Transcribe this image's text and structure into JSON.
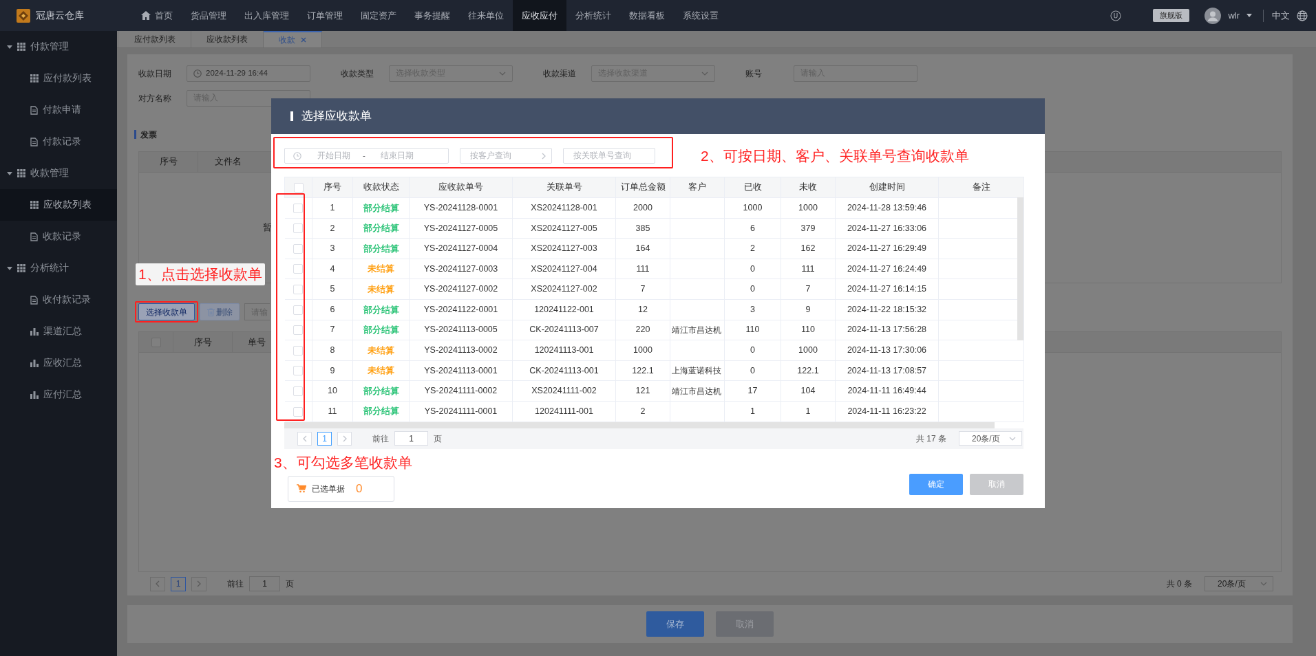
{
  "app": {
    "logo": "冠唐云仓库"
  },
  "top_nav": [
    {
      "label": "首页",
      "kind": "home",
      "selected": false
    },
    {
      "label": "货品管理",
      "kind": "link",
      "selected": false
    },
    {
      "label": "出入库管理",
      "kind": "link",
      "selected": false
    },
    {
      "label": "订单管理",
      "kind": "link",
      "selected": false
    },
    {
      "label": "固定资产",
      "kind": "link",
      "selected": false
    },
    {
      "label": "事务提醒",
      "kind": "link",
      "selected": false
    },
    {
      "label": "往来单位",
      "kind": "link",
      "selected": false
    },
    {
      "label": "应收应付",
      "kind": "link",
      "selected": true
    },
    {
      "label": "分析统计",
      "kind": "link",
      "selected": false
    },
    {
      "label": "数据看板",
      "kind": "link",
      "selected": false
    },
    {
      "label": "系统设置",
      "kind": "link",
      "selected": false
    }
  ],
  "header_right": {
    "edition": "旗舰版",
    "user": "wlr",
    "language": "中文"
  },
  "sidebar": [
    {
      "label": "付款管理",
      "expanded": true,
      "children": [
        {
          "label": "应付款列表",
          "kind": "table",
          "selected": false
        },
        {
          "label": "付款申请",
          "kind": "document",
          "selected": false
        },
        {
          "label": "付款记录",
          "kind": "document",
          "selected": false
        }
      ]
    },
    {
      "label": "收款管理",
      "expanded": true,
      "children": [
        {
          "label": "应收款列表",
          "kind": "table",
          "selected": true
        },
        {
          "label": "收款记录",
          "kind": "document",
          "selected": false
        }
      ]
    },
    {
      "label": "分析统计",
      "expanded": true,
      "children": [
        {
          "label": "收付款记录",
          "kind": "document",
          "selected": false
        },
        {
          "label": "渠道汇总",
          "kind": "chart",
          "selected": false
        },
        {
          "label": "应收汇总",
          "kind": "chart",
          "selected": false
        },
        {
          "label": "应付汇总",
          "kind": "chart",
          "selected": false
        }
      ]
    }
  ],
  "tabs": [
    {
      "label": "应付款列表",
      "selected": false,
      "closable": false
    },
    {
      "label": "应收款列表",
      "selected": false,
      "closable": false
    },
    {
      "label": "收款",
      "selected": true,
      "closable": true
    }
  ],
  "form": {
    "rows": [
      [
        {
          "label": "收款日期",
          "kind": "date",
          "value": "2024-11-29 16:44"
        },
        {
          "label": "收款类型",
          "kind": "select",
          "placeholder": "选择收款类型"
        },
        {
          "label": "收款渠道",
          "kind": "select",
          "placeholder": "选择收款渠道"
        },
        {
          "label": "账号",
          "kind": "text",
          "placeholder": "请输入"
        }
      ],
      [
        {
          "label": "对方名称",
          "kind": "text",
          "placeholder": "请输入"
        }
      ]
    ]
  },
  "invoice": {
    "title": "发票",
    "columns": [
      "序号",
      "文件名"
    ],
    "empty_text": "暂"
  },
  "receipts": {
    "annotation": "1、点击选择收款单",
    "buttons": [
      {
        "label": "选择收款单",
        "kind": "select",
        "disabled": false
      },
      {
        "label": "删除",
        "kind": "delete",
        "disabled": true
      }
    ],
    "search_placeholder": "请输",
    "header_checked": false,
    "columns": [
      "序号",
      "单号"
    ],
    "pager": {
      "prev_disabled": true,
      "page": "1",
      "next_disabled": true,
      "goto_label": "前往",
      "goto_value": "1",
      "page_suffix": "页",
      "total": "共 0 条",
      "page_size": "20条/页"
    }
  },
  "footer_buttons": [
    {
      "label": "保存",
      "kind": "primary"
    },
    {
      "label": "取消",
      "kind": "secondary"
    }
  ],
  "dialog": {
    "title": "选择应收款单",
    "filters": {
      "start_placeholder": "开始日期",
      "separator": "-",
      "end_placeholder": "结束日期",
      "customer_placeholder": "按客户查询",
      "related_placeholder": "按关联单号查询"
    },
    "filter_annotation": "2、可按日期、客户、关联单号查询收款单",
    "table": {
      "header_checked": false,
      "columns": [
        "序号",
        "收款状态",
        "应收款单号",
        "关联单号",
        "订单总金额",
        "客户",
        "已收",
        "未收",
        "创建时间",
        "备注"
      ],
      "rows": [
        {
          "checked": false,
          "no": "1",
          "status": "部分结算",
          "color": "#19be6b",
          "receivable_no": "YS-20241128-0001",
          "related_no": "XS20241128-001",
          "total": "2000",
          "received": "1000",
          "unreceived": "1000",
          "created": "2024-11-28 13:59:46"
        },
        {
          "checked": false,
          "no": "2",
          "status": "部分结算",
          "color": "#19be6b",
          "receivable_no": "YS-20241127-0005",
          "related_no": "XS20241127-005",
          "total": "385",
          "received": "6",
          "unreceived": "379",
          "created": "2024-11-27 16:33:06"
        },
        {
          "checked": false,
          "no": "3",
          "status": "部分结算",
          "color": "#19be6b",
          "receivable_no": "YS-20241127-0004",
          "related_no": "XS20241127-003",
          "total": "164",
          "received": "2",
          "unreceived": "162",
          "created": "2024-11-27 16:29:49"
        },
        {
          "checked": false,
          "no": "4",
          "status": "未结算",
          "color": "#ff9900",
          "receivable_no": "YS-20241127-0003",
          "related_no": "XS20241127-004",
          "total": "111",
          "received": "0",
          "unreceived": "111",
          "created": "2024-11-27 16:24:49"
        },
        {
          "checked": false,
          "no": "5",
          "status": "未结算",
          "color": "#ff9900",
          "receivable_no": "YS-20241127-0002",
          "related_no": "XS20241127-002",
          "total": "7",
          "received": "0",
          "unreceived": "7",
          "created": "2024-11-27 16:14:15"
        },
        {
          "checked": false,
          "no": "6",
          "status": "部分结算",
          "color": "#19be6b",
          "receivable_no": "YS-20241122-0001",
          "related_no": "120241122-001",
          "total": "12",
          "received": "3",
          "unreceived": "9",
          "created": "2024-11-22 18:15:32"
        },
        {
          "checked": false,
          "no": "7",
          "status": "部分结算",
          "color": "#19be6b",
          "receivable_no": "YS-20241113-0005",
          "related_no": "CK-20241113-007",
          "total": "220",
          "customer": "靖江市昌达机",
          "received": "110",
          "unreceived": "110",
          "created": "2024-11-13 17:56:28"
        },
        {
          "checked": false,
          "no": "8",
          "status": "未结算",
          "color": "#ff9900",
          "receivable_no": "YS-20241113-0002",
          "related_no": "120241113-001",
          "total": "1000",
          "received": "0",
          "unreceived": "1000",
          "created": "2024-11-13 17:30:06"
        },
        {
          "checked": false,
          "no": "9",
          "status": "未结算",
          "color": "#ff9900",
          "receivable_no": "YS-20241113-0001",
          "related_no": "CK-20241113-001",
          "total": "122.1",
          "customer": "上海蓝诺科技",
          "received": "0",
          "unreceived": "122.1",
          "created": "2024-11-13 17:08:57"
        },
        {
          "checked": false,
          "no": "10",
          "status": "部分结算",
          "color": "#19be6b",
          "receivable_no": "YS-20241111-0002",
          "related_no": "XS20241111-002",
          "total": "121",
          "customer": "靖江市昌达机",
          "received": "17",
          "unreceived": "104",
          "created": "2024-11-11 16:49:44"
        },
        {
          "checked": false,
          "no": "11",
          "status": "部分结算",
          "color": "#19be6b",
          "receivable_no": "YS-20241111-0001",
          "related_no": "120241111-001",
          "total": "2",
          "received": "1",
          "unreceived": "1",
          "created": "2024-11-11 16:23:22"
        }
      ]
    },
    "pager": {
      "prev_disabled": true,
      "page": "1",
      "next_disabled": true,
      "goto_label": "前往",
      "goto_value": "1",
      "page_suffix": "页",
      "total": "共 17 条",
      "page_size": "20条/页"
    },
    "select_annotation": "3、可勾选多笔收款单",
    "selected_label": "已选单据",
    "selected_count": "0",
    "buttons": [
      {
        "label": "确定",
        "kind": "primary"
      },
      {
        "label": "取消",
        "kind": "secondary"
      }
    ]
  }
}
